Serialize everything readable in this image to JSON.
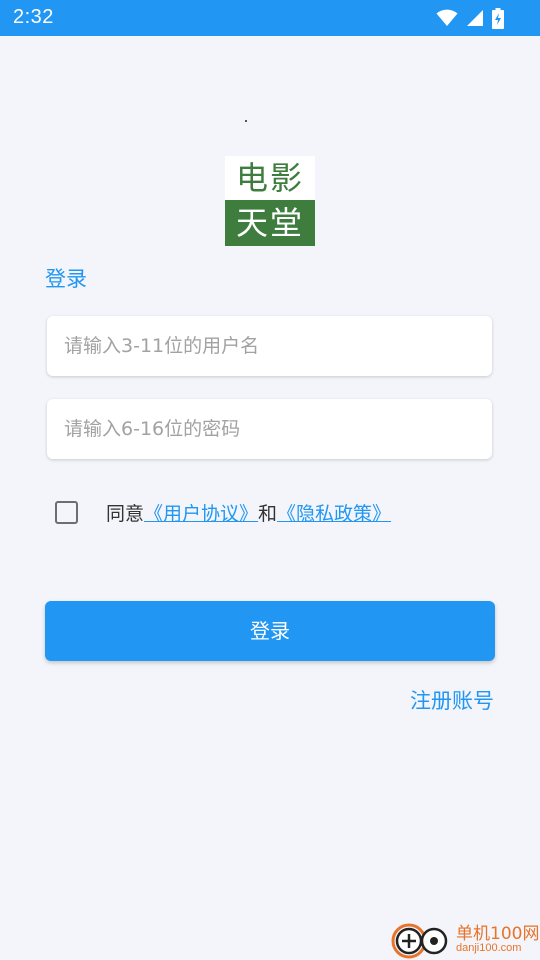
{
  "status_bar": {
    "time": "2:32",
    "icons": [
      "wifi-icon",
      "signal-icon",
      "battery-charging-icon"
    ]
  },
  "logo": {
    "line1": "电影",
    "line2": "天堂"
  },
  "login": {
    "title": "登录",
    "username_placeholder": "请输入3-11位的用户名",
    "password_placeholder": "请输入6-16位的密码",
    "agree_prefix": "同意",
    "user_agreement": "《用户协议》",
    "and": "和",
    "privacy_policy": "《隐私政策》",
    "checkbox_checked": false,
    "login_button": "登录",
    "register_link": "注册账号"
  },
  "watermark": {
    "title": "单机100网",
    "subtitle": "danji100.com"
  },
  "colors": {
    "accent": "#2196f3",
    "background": "#f3f5fa",
    "logo_green": "#3e7d3d",
    "watermark_orange": "#e8732a"
  }
}
